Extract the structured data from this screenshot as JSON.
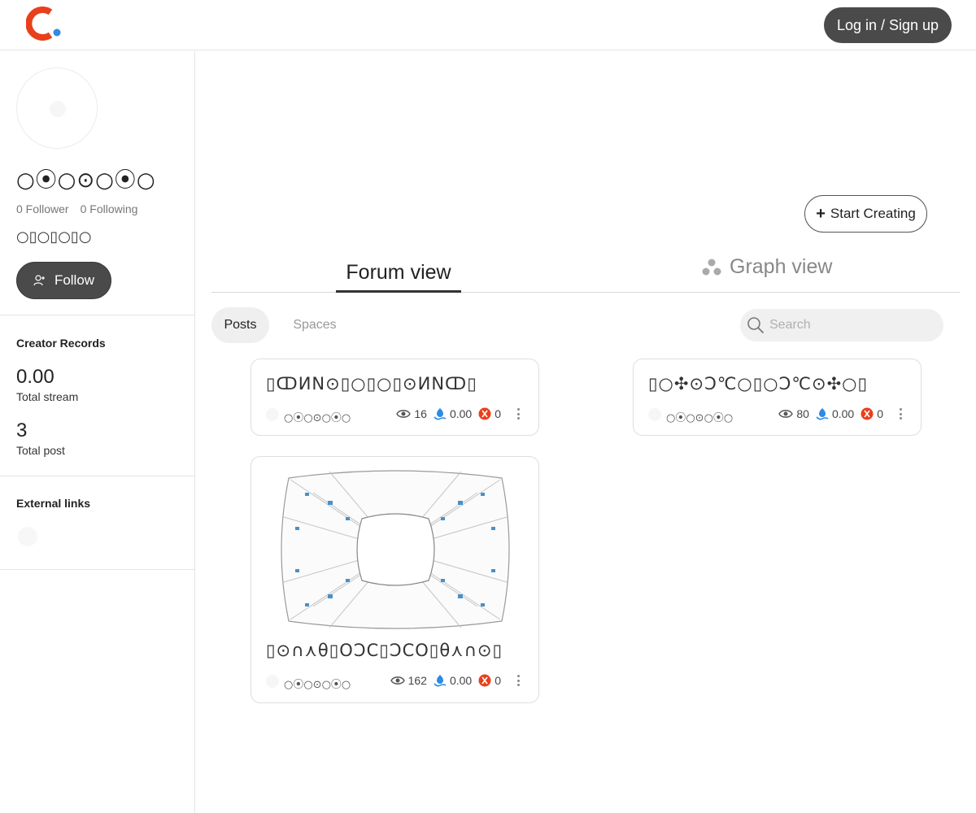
{
  "header": {
    "login_label": "Log in / Sign up",
    "brand_colors": {
      "primary": "#e8401c",
      "accent": "#2b8be6"
    }
  },
  "profile": {
    "name": "○⦿○⊙○⦿○",
    "followers": "0 Follower",
    "following": "0 Following",
    "bio": "○▯○▯○▯○",
    "follow_label": "Follow"
  },
  "records": {
    "title": "Creator Records",
    "total_stream_value": "0.00",
    "total_stream_label": "Total stream",
    "total_post_value": "3",
    "total_post_label": "Total post"
  },
  "external_links": {
    "title": "External links"
  },
  "main": {
    "start_creating_label": "Start Creating",
    "view_tabs": [
      {
        "label": "Forum view",
        "active": true
      },
      {
        "label": "Graph view",
        "active": false
      }
    ],
    "sub_tabs": [
      {
        "label": "Posts",
        "active": true
      },
      {
        "label": "Spaces",
        "active": false
      }
    ],
    "search_placeholder": "Search"
  },
  "posts": [
    {
      "title": "▯ↀИΝ⊙▯○▯○▯⊙ИΝↀ▯",
      "author": "○⦿○⊙○⦿○",
      "views": "16",
      "stream": "0.00",
      "tips": "0"
    },
    {
      "title": "▯○✣⊙Ↄ℃○▯○Ↄ℃⊙✣○▯",
      "author": "○⦿○⊙○⦿○",
      "views": "80",
      "stream": "0.00",
      "tips": "0"
    },
    {
      "title": "▯⊙∩⋏θ▯OↃC▯ↃCO▯θ⋏∩⊙▯",
      "author": "○⦿○⊙○⦿○",
      "views": "162",
      "stream": "0.00",
      "tips": "0"
    }
  ],
  "icons": [
    "logo-icon",
    "user-plus-icon",
    "plus-icon",
    "graph-icon",
    "search-icon",
    "eye-icon",
    "stream-icon",
    "tip-icon",
    "more-icon"
  ]
}
